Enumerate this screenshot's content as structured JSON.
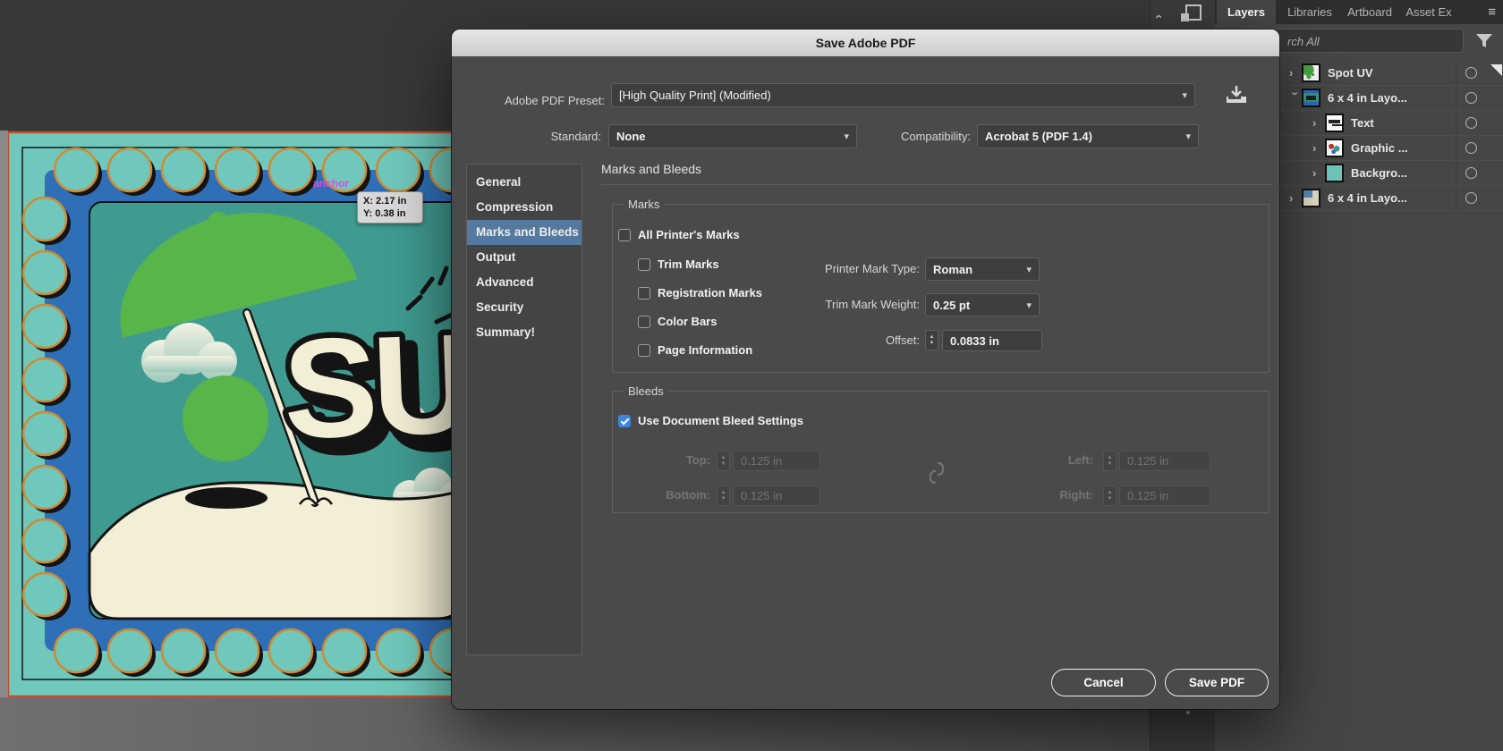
{
  "canvas": {
    "anchor_label": "anchor",
    "tooltip_line1": "X: 2.17 in",
    "tooltip_line2": "Y: 0.38 in",
    "artwork_text": "SUM"
  },
  "dialog": {
    "title": "Save Adobe PDF",
    "preset_label": "Adobe PDF Preset:",
    "preset_value": "[High Quality Print] (Modified)",
    "standard_label": "Standard:",
    "standard_value": "None",
    "compatibility_label": "Compatibility:",
    "compatibility_value": "Acrobat 5 (PDF 1.4)",
    "sections": [
      "General",
      "Compression",
      "Marks and Bleeds",
      "Output",
      "Advanced",
      "Security",
      "Summary!"
    ],
    "selected_section": "Marks and Bleeds",
    "panel_heading": "Marks and Bleeds",
    "marks": {
      "group_label": "Marks",
      "cb_all": "All Printer's Marks",
      "cb_trim": "Trim Marks",
      "cb_reg": "Registration Marks",
      "cb_color": "Color Bars",
      "cb_page": "Page Information",
      "cb_all_checked": false,
      "cb_trim_checked": false,
      "cb_reg_checked": false,
      "cb_color_checked": false,
      "cb_page_checked": false,
      "printer_mark_type_label": "Printer Mark Type:",
      "printer_mark_type_value": "Roman",
      "trim_mark_weight_label": "Trim Mark Weight:",
      "trim_mark_weight_value": "0.25 pt",
      "offset_label": "Offset:",
      "offset_value": "0.0833 in"
    },
    "bleeds": {
      "group_label": "Bleeds",
      "use_doc_label": "Use Document Bleed Settings",
      "use_doc_checked": true,
      "top_label": "Top:",
      "top_value": "0.125 in",
      "bottom_label": "Bottom:",
      "bottom_value": "0.125 in",
      "left_label": "Left:",
      "left_value": "0.125 in",
      "right_label": "Right:",
      "right_value": "0.125 in"
    },
    "cancel_label": "Cancel",
    "save_label": "Save PDF"
  },
  "layers_panel": {
    "tabs": [
      "Layers",
      "Libraries",
      "Artboard",
      "Asset Ex"
    ],
    "active_tab": "Layers",
    "search_text": "rch All",
    "rows": [
      {
        "name": "Spot UV"
      },
      {
        "name": "6 x 4 in Layo..."
      },
      {
        "name": "Text"
      },
      {
        "name": "Graphic ..."
      },
      {
        "name": "Backgro..."
      },
      {
        "name": "6 x 4 in Layo..."
      }
    ]
  },
  "colors": {
    "selection_blue": "#54789e",
    "checkbox_blue": "#3b86de",
    "stamp_blue": "#2f6fb7",
    "card_teal": "#6fc8bb",
    "inner_teal": "#3f9b90",
    "leaf_green": "#58b54a",
    "cream": "#f3eed6",
    "scallop_orange": "#d08a30",
    "titlebar_gray": "#d9d9d9"
  }
}
